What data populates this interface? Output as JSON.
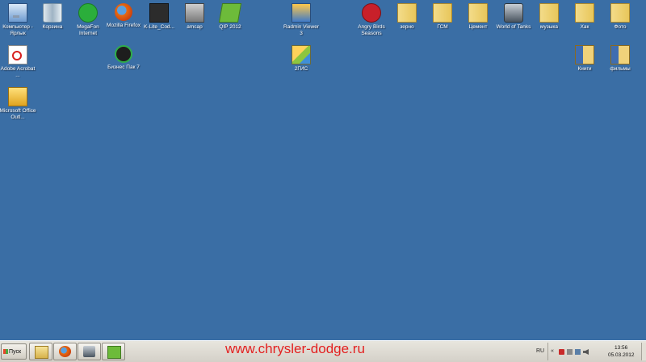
{
  "desktop": {
    "background": "#3a6ea5",
    "icons": [
      {
        "label": "Компьютер - Ярлык",
        "icon": "computer-icon"
      },
      {
        "label": "Корзина",
        "icon": "recycle-bin-icon"
      },
      {
        "label": "MegaFon Internet",
        "icon": "megafon-icon"
      },
      {
        "label": "Mozilla Firefox",
        "icon": "firefox-icon"
      },
      {
        "label": "K-Lite_Cod...",
        "icon": "klite-codec-icon"
      },
      {
        "label": "amcap",
        "icon": "amcap-icon"
      },
      {
        "label": "QIP 2012",
        "icon": "qip-icon"
      },
      {
        "label": "Radmin Viewer 3",
        "icon": "radmin-icon"
      },
      {
        "label": "Angry Birds Seasons",
        "icon": "angry-birds-icon"
      },
      {
        "label": "зерно",
        "icon": "folder-icon"
      },
      {
        "label": "ГСМ",
        "icon": "folder-icon"
      },
      {
        "label": "Цемент",
        "icon": "folder-icon"
      },
      {
        "label": "World of Tanks",
        "icon": "world-of-tanks-icon"
      },
      {
        "label": "музыка",
        "icon": "folder-icon"
      },
      {
        "label": "Хак",
        "icon": "folder-icon"
      },
      {
        "label": "Фото",
        "icon": "folder-icon"
      },
      {
        "label": "Adobe Acrobat ...",
        "icon": "acrobat-icon"
      },
      {
        "label": "Бизнес Пак 7",
        "icon": "business-pack-icon"
      },
      {
        "label": "2ГИС",
        "icon": "2gis-icon"
      },
      {
        "label": "Книги",
        "icon": "books-folder-icon"
      },
      {
        "label": "фильмы",
        "icon": "films-folder-icon"
      },
      {
        "label": "Microsoft Office Outl...",
        "icon": "outlook-icon"
      }
    ]
  },
  "taskbar": {
    "start_label": "Пуск",
    "pinned": [
      {
        "name": "explorer",
        "icon": "folder-icon"
      },
      {
        "name": "firefox",
        "icon": "firefox-icon"
      },
      {
        "name": "world-of-tanks",
        "icon": "world-of-tanks-icon"
      },
      {
        "name": "qip",
        "icon": "qip-icon"
      }
    ],
    "watermark": "www.chrysler-dodge.ru",
    "language": "RU",
    "tray_chevron": "«",
    "clock_time": "13:56",
    "clock_date": "05.03.2012"
  }
}
